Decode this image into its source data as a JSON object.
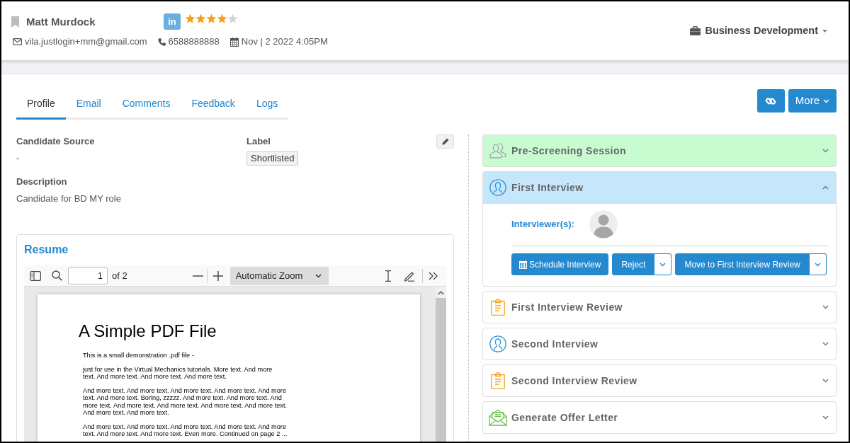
{
  "candidate": {
    "name": "Matt Murdock",
    "profile_badge": "in",
    "stars": 4,
    "email": "vila.justlogin+mm@gmail.com",
    "phone": "6588888888",
    "date": "Nov | 2 2022 4:05PM"
  },
  "department": "Business Development",
  "tabs": [
    {
      "label": "Profile",
      "selected": true
    },
    {
      "label": "Email",
      "selected": false
    },
    {
      "label": "Comments",
      "selected": false
    },
    {
      "label": "Feedback",
      "selected": false
    },
    {
      "label": "Logs",
      "selected": false
    }
  ],
  "actions": {
    "more": "More"
  },
  "profile": {
    "source": {
      "label": "Candidate Source",
      "value": "-"
    },
    "tag": {
      "label": "Label",
      "value": "Shortlisted"
    },
    "description": {
      "label": "Description",
      "value": "Candidate for BD MY role"
    }
  },
  "resume": {
    "title": "Resume",
    "viewer": {
      "page": "1",
      "page_total": "of 2",
      "zoom": "Automatic Zoom",
      "document": {
        "heading": "A Simple PDF File",
        "paragraphs": [
          [
            "This is a small demonstration .pdf file -"
          ],
          [
            "just for use in the Virtual Mechanics tutorials. More text. And more",
            "text. And more text. And more text. And more text."
          ],
          [
            "And more text. And more text. And more text. And more text. And more",
            "text. And more text. Boring, zzzzz. And more text. And more text. And",
            "more text. And more text. And more text. And more text. And more text.",
            "And more text. And more text."
          ],
          [
            "And more text. And more text. And more text. And more text. And more",
            "text. And more text. And more text. Even more. Continued on page 2 ..."
          ]
        ]
      }
    }
  },
  "stages": [
    {
      "title": "Pre-Screening Session",
      "kind": "group",
      "color": "#c8fbd0",
      "expanded": false
    },
    {
      "title": "First Interview",
      "kind": "interview",
      "color": "#c5e6fb",
      "expanded": true,
      "interviewers_label": "Interviewer(s):",
      "buttons": [
        {
          "label": "Schedule Interview",
          "kind": "calendar"
        },
        {
          "label": "Reject",
          "kind": "split"
        },
        {
          "label": "Move to First Interview Review",
          "kind": "split"
        }
      ]
    },
    {
      "title": "First Interview Review",
      "kind": "review",
      "color": "#ffffff",
      "expanded": false
    },
    {
      "title": "Second Interview",
      "kind": "interview",
      "color": "#ffffff",
      "expanded": false
    },
    {
      "title": "Second Interview Review",
      "kind": "review",
      "color": "#ffffff",
      "expanded": false
    },
    {
      "title": "Generate Offer Letter",
      "kind": "offer",
      "color": "#ffffff",
      "expanded": false
    }
  ]
}
